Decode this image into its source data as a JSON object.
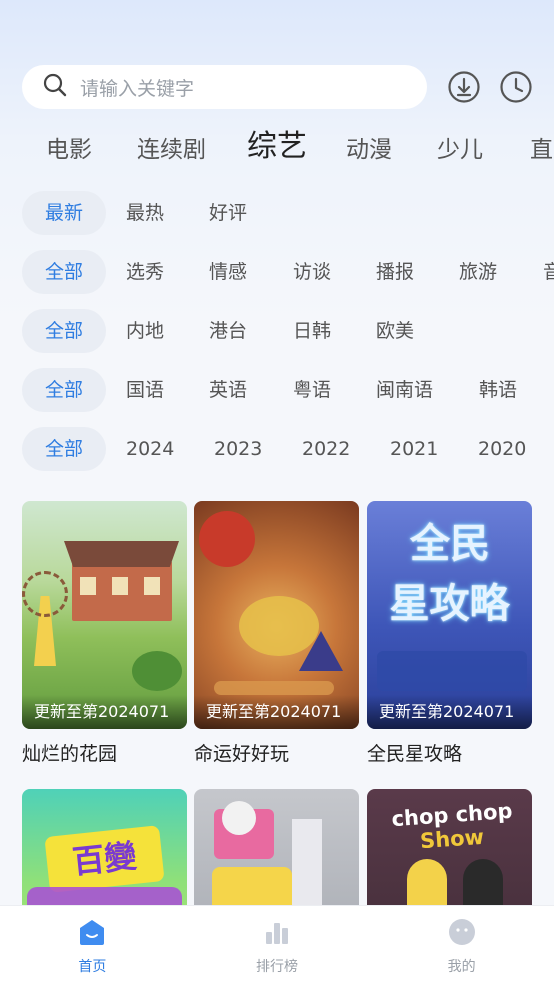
{
  "search": {
    "placeholder": "请输入关键字"
  },
  "header_icons": [
    "download-icon",
    "history-icon"
  ],
  "category_tabs": [
    {
      "label": "电影"
    },
    {
      "label": "连续剧"
    },
    {
      "label": "综艺",
      "active": true
    },
    {
      "label": "动漫"
    },
    {
      "label": "少儿"
    },
    {
      "label": "直"
    }
  ],
  "filters": {
    "sort": [
      "最新",
      "最热",
      "好评"
    ],
    "type": [
      "全部",
      "选秀",
      "情感",
      "访谈",
      "播报",
      "旅游",
      "音"
    ],
    "region": [
      "全部",
      "内地",
      "港台",
      "日韩",
      "欧美"
    ],
    "language": [
      "全部",
      "国语",
      "英语",
      "粤语",
      "闽南语",
      "韩语"
    ],
    "year": [
      "全部",
      "2024",
      "2023",
      "2022",
      "2021",
      "2020"
    ]
  },
  "shows": [
    {
      "title": "灿烂的花园",
      "update": "更新至第2024071"
    },
    {
      "title": "命运好好玩",
      "update": "更新至第2024071"
    },
    {
      "title": "全民星攻略",
      "update": "更新至第2024071"
    },
    {
      "title": "",
      "update": ""
    },
    {
      "title": "",
      "update": ""
    },
    {
      "title": "",
      "update": ""
    }
  ],
  "poster_text": [
    "全民",
    "星攻略",
    "百變",
    "chop chop",
    "Show"
  ],
  "bottom_nav": [
    {
      "label": "首页",
      "icon": "home-icon",
      "active": true
    },
    {
      "label": "排行榜",
      "icon": "ranking-icon"
    },
    {
      "label": "我的",
      "icon": "profile-icon"
    }
  ],
  "colors": {
    "accent": "#2f7de1",
    "chip_bg": "#e9edf4",
    "muted": "#9aa0a8"
  }
}
